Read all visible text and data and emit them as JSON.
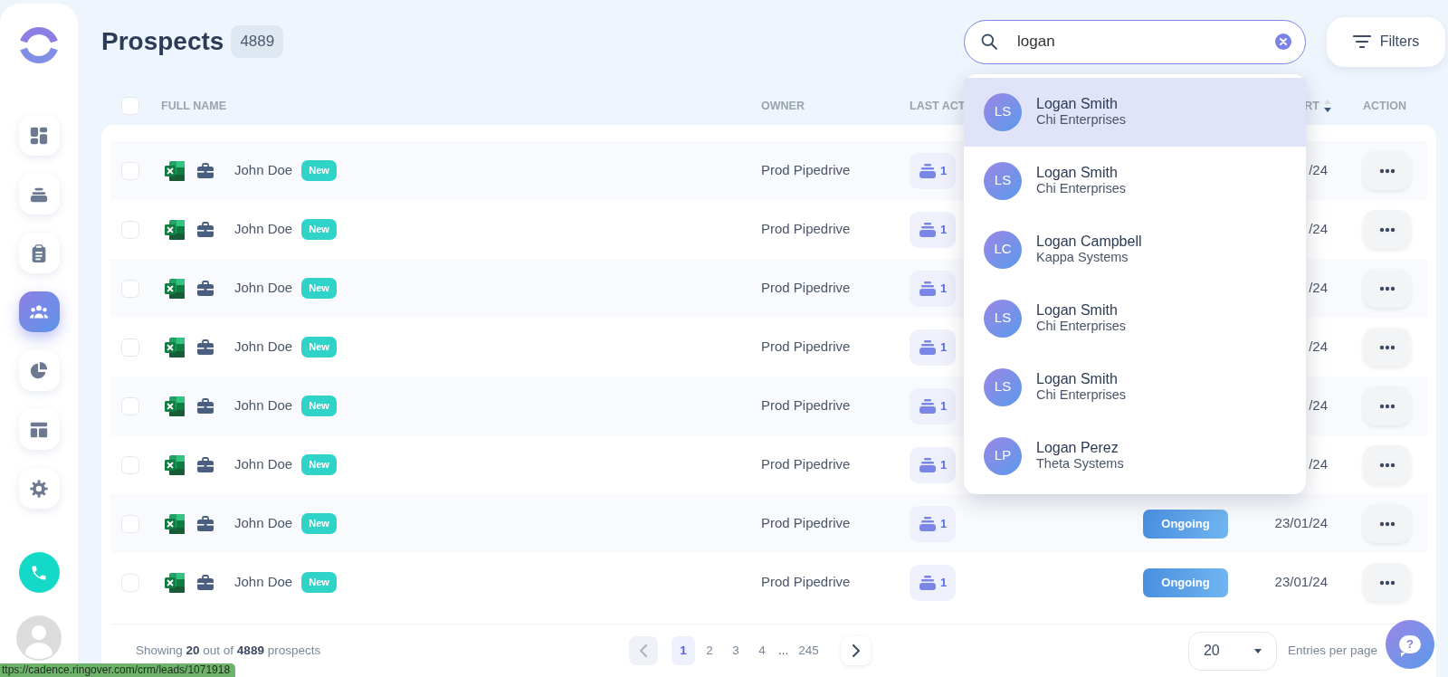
{
  "sidebar": {
    "items": [
      {
        "selected": false
      },
      {
        "selected": false
      },
      {
        "selected": false
      },
      {
        "selected": true
      },
      {
        "selected": false
      },
      {
        "selected": false
      },
      {
        "selected": false
      }
    ]
  },
  "header": {
    "title": "Prospects",
    "count": "4889"
  },
  "search": {
    "value": "logan",
    "results": [
      {
        "initials": "LS",
        "name": "Logan Smith",
        "company": "Chi Enterprises",
        "selected": true
      },
      {
        "initials": "LS",
        "name": "Logan Smith",
        "company": "Chi Enterprises",
        "selected": false
      },
      {
        "initials": "LC",
        "name": "Logan Campbell",
        "company": "Kappa Systems",
        "selected": false
      },
      {
        "initials": "LS",
        "name": "Logan Smith",
        "company": "Chi Enterprises",
        "selected": false
      },
      {
        "initials": "LS",
        "name": "Logan Smith",
        "company": "Chi Enterprises",
        "selected": false
      },
      {
        "initials": "LP",
        "name": "Logan Perez",
        "company": "Theta Systems",
        "selected": false
      }
    ]
  },
  "filters_button": {
    "label": "Filters"
  },
  "table": {
    "select_all": {
      "checked": false
    },
    "columns": [
      {
        "kind": "name",
        "label": "FULL NAME"
      },
      {
        "kind": "owner",
        "label": "OWNER"
      },
      {
        "kind": "activity",
        "label": "LAST ACT"
      },
      {
        "kind": "date",
        "label": "RT",
        "sort_descending": true
      },
      {
        "kind": "action",
        "label": "ACTION"
      }
    ],
    "rows": [
      {
        "checked": false,
        "name": "John Doe",
        "tag": "New",
        "owner": "Prod Pipedrive",
        "activity": "1",
        "date": "/24"
      },
      {
        "checked": false,
        "name": "John Doe",
        "tag": "New",
        "owner": "Prod Pipedrive",
        "activity": "1",
        "date": "/24"
      },
      {
        "checked": false,
        "name": "John Doe",
        "tag": "New",
        "owner": "Prod Pipedrive",
        "activity": "1",
        "date": "/24"
      },
      {
        "checked": false,
        "name": "John Doe",
        "tag": "New",
        "owner": "Prod Pipedrive",
        "activity": "1",
        "date": "/24"
      },
      {
        "checked": false,
        "name": "John Doe",
        "tag": "New",
        "owner": "Prod Pipedrive",
        "activity": "1",
        "date": "/24"
      },
      {
        "checked": false,
        "name": "John Doe",
        "tag": "New",
        "owner": "Prod Pipedrive",
        "activity": "1",
        "date": "/24"
      },
      {
        "checked": false,
        "name": "John Doe",
        "tag": "New",
        "owner": "Prod Pipedrive",
        "activity": "1",
        "status": "Ongoing",
        "date": "23/01/24"
      },
      {
        "checked": false,
        "name": "John Doe",
        "tag": "New",
        "owner": "Prod Pipedrive",
        "activity": "1",
        "status": "Ongoing",
        "date": "23/01/24"
      }
    ]
  },
  "footer": {
    "summary": "Showing **20** out of **4889** prospects",
    "pagination": {
      "previous": {
        "disabled": true
      },
      "pages": [
        {
          "label": "1",
          "selected": true
        },
        {
          "label": "2",
          "selected": false
        },
        {
          "label": "3",
          "selected": false
        },
        {
          "label": "4",
          "selected": false
        }
      ],
      "gap": "...",
      "last_page": {
        "label": "245",
        "selected": false
      },
      "next": {
        "disabled": false
      }
    },
    "per_page": {
      "value": "20",
      "label": "Entries per page"
    }
  },
  "help_button": {
    "label": "?"
  },
  "status_url": "ttps://cadence.ringover.com/crm/leads/1071918"
}
